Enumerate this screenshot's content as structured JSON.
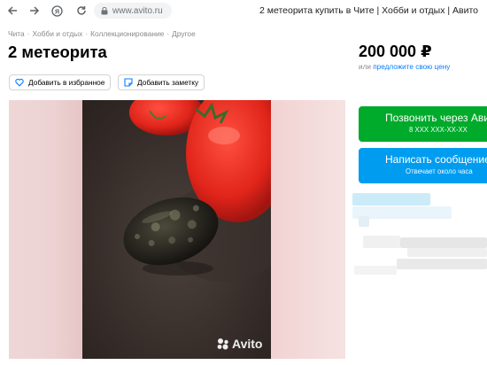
{
  "browser": {
    "url": "www.avito.ru",
    "tab_title": "2 метеорита купить в Чите | Хобби и отдых | Авито"
  },
  "breadcrumb": [
    "Чита",
    "Хобби и отдых",
    "Коллекционирование",
    "Другое"
  ],
  "listing": {
    "title": "2 метеорита",
    "price": "200 000 ₽",
    "price_prefix": "или",
    "price_link": "предложите свою цену"
  },
  "actions": {
    "favorite_label": "Добавить в избранное",
    "note_label": "Добавить заметку"
  },
  "contact": {
    "call_label": "Позвонить через Авито",
    "call_sub": "8 ХХХ ХХХ-ХХ-ХХ",
    "message_label": "Написать сообщение",
    "message_sub": "Отвечает около часа"
  },
  "gallery": {
    "watermark": "Avito"
  },
  "colors": {
    "call_green": "#00aa2b",
    "message_blue": "#009cf0",
    "link_blue": "#0a7eff"
  }
}
